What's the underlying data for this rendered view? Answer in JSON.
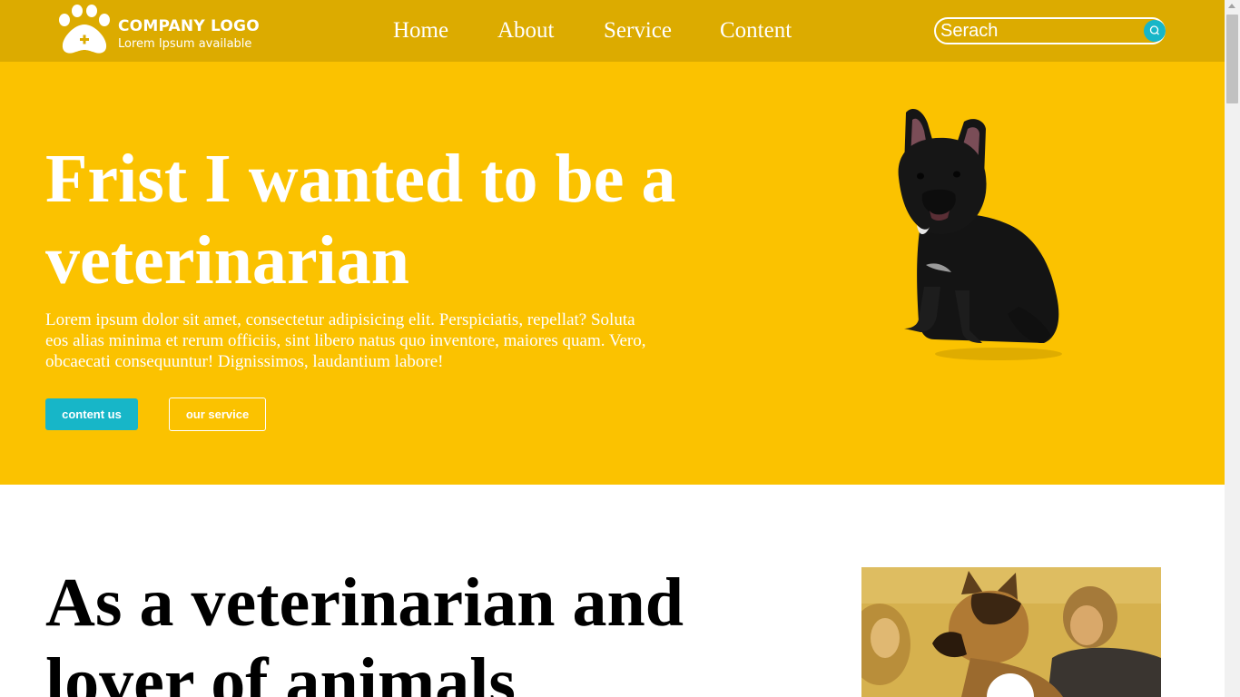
{
  "header": {
    "logo_title": "COMPANY LOGO",
    "logo_subtitle": "Lorem Ipsum available",
    "nav": [
      "Home",
      "About",
      "Service",
      "Content"
    ],
    "search_placeholder": "Serach"
  },
  "hero": {
    "title": "Frist I wanted to be a veterinarian",
    "text": "Lorem ipsum dolor sit amet, consectetur adipisicing elit. Perspiciatis, repellat? Soluta eos alias minima et rerum officiis, sint libero natus quo inventore, maiores quam. Vero, obcaecati consequuntur! Dignissimos, laudantium labore!",
    "primary_button": "content us",
    "secondary_button": "our service"
  },
  "about": {
    "title": "As a veterinarian and lover of animals"
  },
  "colors": {
    "header_bg": "#dcab00",
    "hero_bg": "#fbc200",
    "accent": "#17b6c8",
    "text_light": "#ffffff"
  },
  "icons": {
    "logo": "paw-plus-icon",
    "search": "search-icon",
    "dog": "french-bulldog-image",
    "photo": "vet-with-german-shepherd-photo"
  }
}
